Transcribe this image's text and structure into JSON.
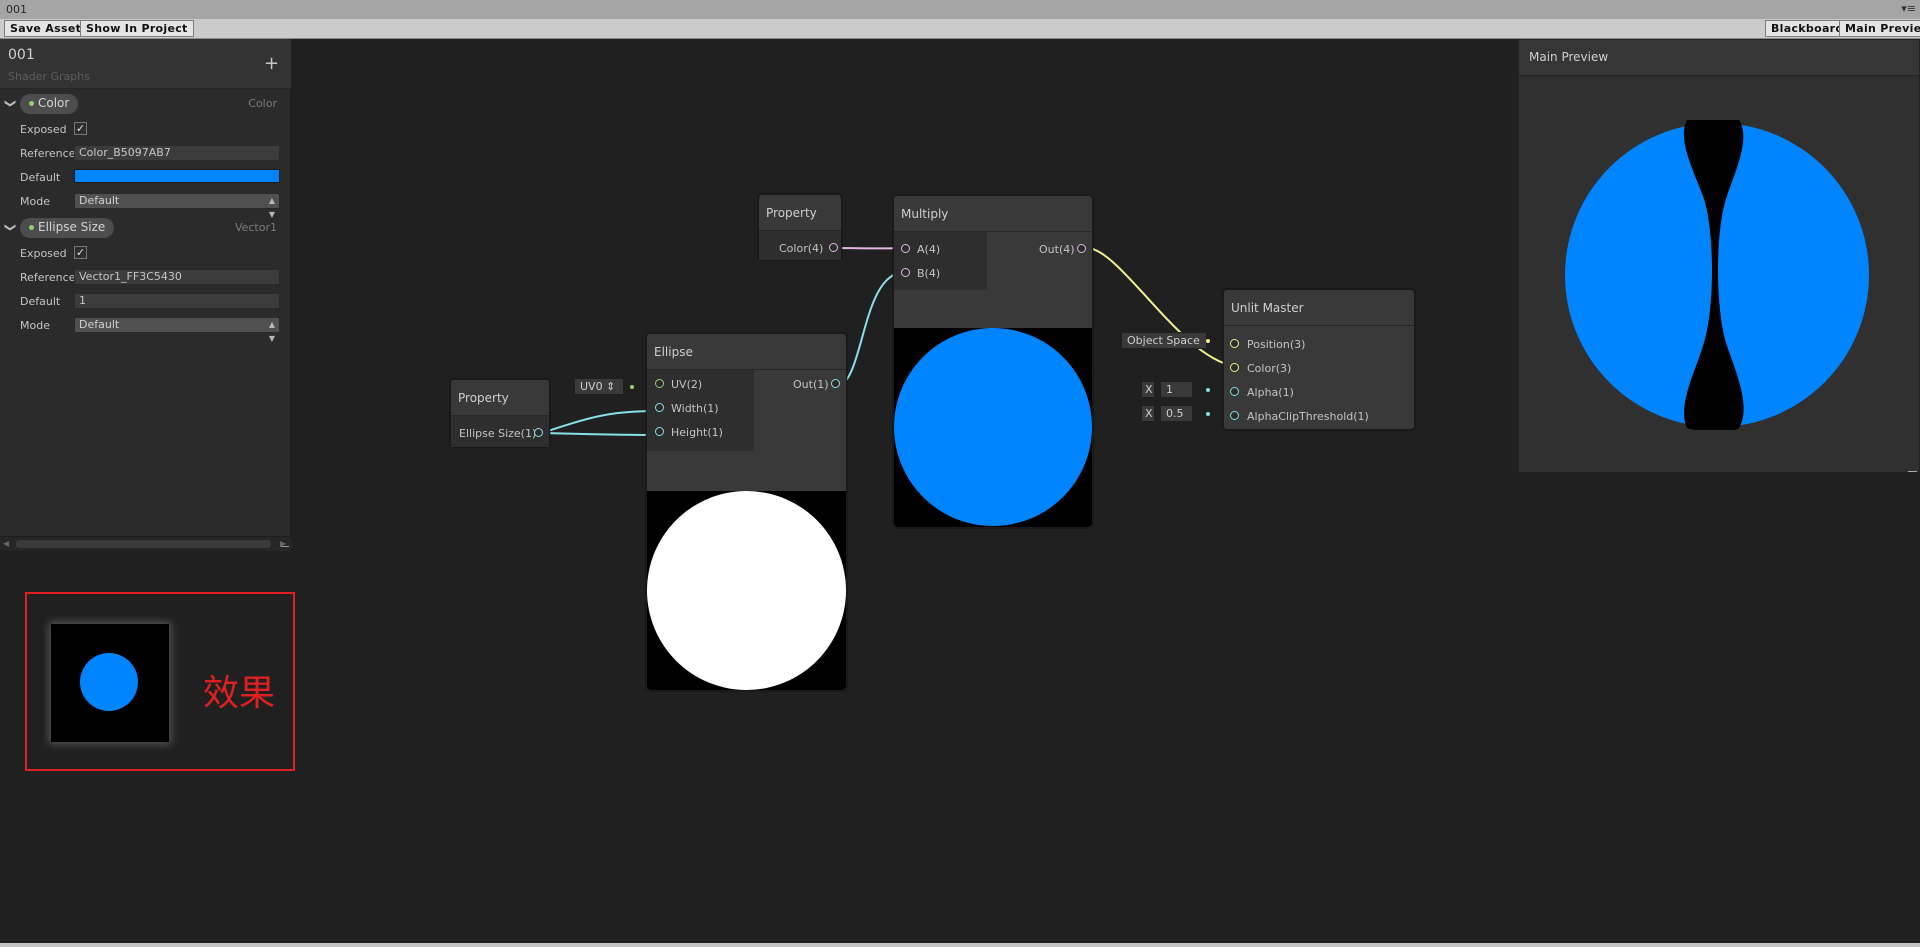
{
  "window": {
    "title": "001",
    "menu_glyph": "▾≡"
  },
  "toolbar": {
    "save_asset": "Save Asset",
    "show_in_project": "Show In Project",
    "blackboard": "Blackboard",
    "main_preview": "Main Preview"
  },
  "blackboard": {
    "title": "001",
    "subtitle": "Shader Graphs",
    "add_icon": "+",
    "properties": [
      {
        "name": "Color",
        "type": "Color",
        "exposed_label": "Exposed",
        "exposed": true,
        "reference_label": "Reference",
        "reference": "Color_B5097AB7",
        "default_label": "Default",
        "default_color": "#0085ff",
        "mode_label": "Mode",
        "mode": "Default"
      },
      {
        "name": "Ellipse Size",
        "type": "Vector1",
        "exposed_label": "Exposed",
        "exposed": true,
        "reference_label": "Reference",
        "reference": "Vector1_FF3C5430",
        "default_label": "Default",
        "default_value": "1",
        "mode_label": "Mode",
        "mode": "Default"
      }
    ]
  },
  "nodes": {
    "property_color": {
      "title": "Property",
      "out": "Color(4)"
    },
    "property_size": {
      "title": "Property",
      "out": "Ellipse Size(1)"
    },
    "ellipse": {
      "title": "Ellipse",
      "inputs": [
        "UV(2)",
        "Width(1)",
        "Height(1)"
      ],
      "out": "Out(1)",
      "uv_field": "UV0",
      "uv_arrows": "⇕"
    },
    "multiply": {
      "title": "Multiply",
      "inputs": [
        "A(4)",
        "B(4)"
      ],
      "out": "Out(4)"
    },
    "unlit_master": {
      "title": "Unlit Master",
      "inputs": [
        "Position(3)",
        "Color(3)",
        "Alpha(1)",
        "AlphaClipThreshold(1)"
      ],
      "object_space": "Object Space",
      "alpha_axis": "X",
      "alpha_value": "1",
      "clip_axis": "X",
      "clip_value": "0.5"
    }
  },
  "main_preview": {
    "title": "Main Preview"
  },
  "effect": {
    "label": "效果"
  },
  "colors": {
    "blue": "#0085ff",
    "port_pink": "#e6b4e6",
    "port_cyan": "#87e0e8",
    "port_yellow": "#f0f08c",
    "port_green": "#9ad06e",
    "effect_red": "#e02020"
  },
  "icons": {
    "chevron": "chevron-right-icon",
    "checkmark": "checkmark-icon",
    "dropdown_arrows": "updown-arrows-icon"
  }
}
